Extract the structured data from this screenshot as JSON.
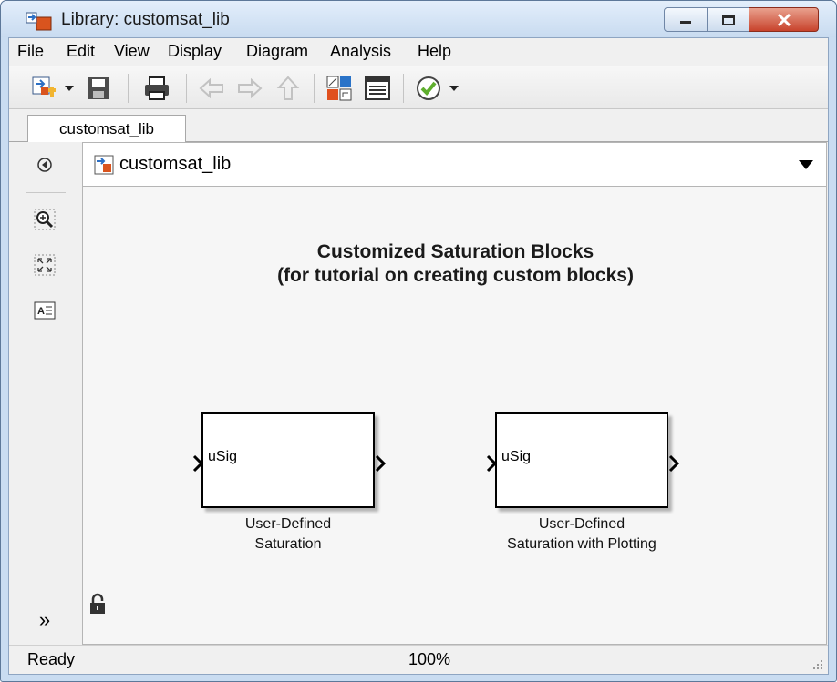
{
  "window": {
    "title": "Library: customsat_lib"
  },
  "menu": {
    "items": [
      "File",
      "Edit",
      "View",
      "Display",
      "Diagram",
      "Analysis",
      "Help"
    ]
  },
  "toolbar": {
    "icons": [
      "new-model-icon",
      "dropdown-arrow-icon",
      "save-icon",
      "print-icon",
      "back-icon",
      "forward-icon",
      "up-icon",
      "library-browser-icon",
      "model-explorer-icon",
      "check-icon",
      "dropdown-arrow-icon"
    ]
  },
  "tabs": [
    {
      "label": "customsat_lib"
    }
  ],
  "address": {
    "path": "customsat_lib"
  },
  "canvas": {
    "title_line1": "Customized Saturation Blocks",
    "title_line2": "(for tutorial on creating custom blocks)",
    "blocks": [
      {
        "port": "uSig",
        "name_line1": "User-Defined",
        "name_line2": "Saturation"
      },
      {
        "port": "uSig",
        "name_line1": "User-Defined",
        "name_line2": "Saturation with Plotting"
      }
    ]
  },
  "sidebar": {
    "expand": "»"
  },
  "status": {
    "text": "Ready",
    "zoom": "100%"
  },
  "colors": {
    "titlebar": "#c8dbf0",
    "close_button": "#c8432c",
    "canvas": "#f6f6f6"
  }
}
